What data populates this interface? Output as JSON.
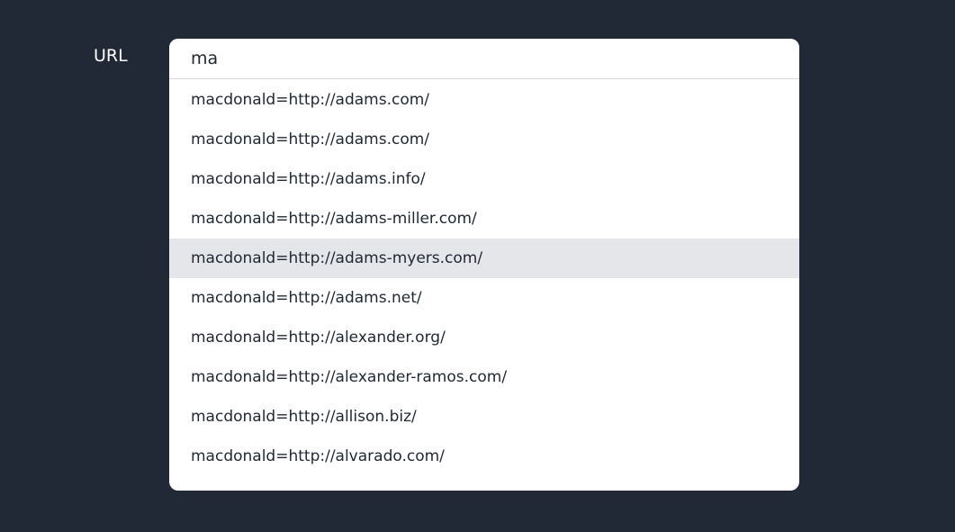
{
  "form": {
    "url_label": "URL",
    "url_input_value": "ma"
  },
  "suggestions": [
    "macdonald=http://adams.com/",
    "macdonald=http://adams.com/",
    "macdonald=http://adams.info/",
    "macdonald=http://adams-miller.com/",
    "macdonald=http://adams-myers.com/",
    "macdonald=http://adams.net/",
    "macdonald=http://alexander.org/",
    "macdonald=http://alexander-ramos.com/",
    "macdonald=http://allison.biz/",
    "macdonald=http://alvarado.com/"
  ],
  "highlighted_suggestion": 4,
  "colors": {
    "background": "#212936",
    "highlight": "#e5e6e9"
  }
}
